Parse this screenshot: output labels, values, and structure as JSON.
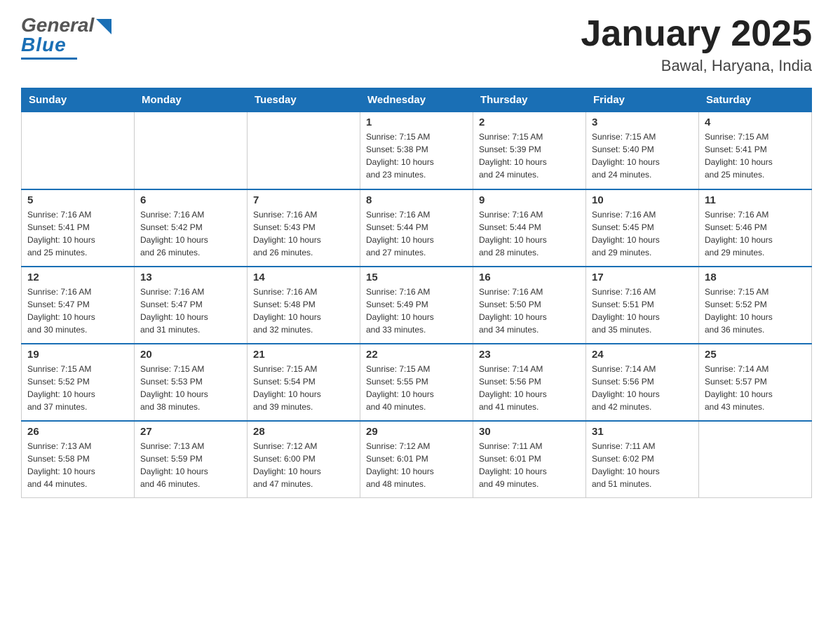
{
  "header": {
    "logo_general": "General",
    "logo_blue": "Blue",
    "month_year": "January 2025",
    "location": "Bawal, Haryana, India"
  },
  "days_of_week": [
    "Sunday",
    "Monday",
    "Tuesday",
    "Wednesday",
    "Thursday",
    "Friday",
    "Saturday"
  ],
  "weeks": [
    [
      {
        "day": "",
        "info": ""
      },
      {
        "day": "",
        "info": ""
      },
      {
        "day": "",
        "info": ""
      },
      {
        "day": "1",
        "info": "Sunrise: 7:15 AM\nSunset: 5:38 PM\nDaylight: 10 hours\nand 23 minutes."
      },
      {
        "day": "2",
        "info": "Sunrise: 7:15 AM\nSunset: 5:39 PM\nDaylight: 10 hours\nand 24 minutes."
      },
      {
        "day": "3",
        "info": "Sunrise: 7:15 AM\nSunset: 5:40 PM\nDaylight: 10 hours\nand 24 minutes."
      },
      {
        "day": "4",
        "info": "Sunrise: 7:15 AM\nSunset: 5:41 PM\nDaylight: 10 hours\nand 25 minutes."
      }
    ],
    [
      {
        "day": "5",
        "info": "Sunrise: 7:16 AM\nSunset: 5:41 PM\nDaylight: 10 hours\nand 25 minutes."
      },
      {
        "day": "6",
        "info": "Sunrise: 7:16 AM\nSunset: 5:42 PM\nDaylight: 10 hours\nand 26 minutes."
      },
      {
        "day": "7",
        "info": "Sunrise: 7:16 AM\nSunset: 5:43 PM\nDaylight: 10 hours\nand 26 minutes."
      },
      {
        "day": "8",
        "info": "Sunrise: 7:16 AM\nSunset: 5:44 PM\nDaylight: 10 hours\nand 27 minutes."
      },
      {
        "day": "9",
        "info": "Sunrise: 7:16 AM\nSunset: 5:44 PM\nDaylight: 10 hours\nand 28 minutes."
      },
      {
        "day": "10",
        "info": "Sunrise: 7:16 AM\nSunset: 5:45 PM\nDaylight: 10 hours\nand 29 minutes."
      },
      {
        "day": "11",
        "info": "Sunrise: 7:16 AM\nSunset: 5:46 PM\nDaylight: 10 hours\nand 29 minutes."
      }
    ],
    [
      {
        "day": "12",
        "info": "Sunrise: 7:16 AM\nSunset: 5:47 PM\nDaylight: 10 hours\nand 30 minutes."
      },
      {
        "day": "13",
        "info": "Sunrise: 7:16 AM\nSunset: 5:47 PM\nDaylight: 10 hours\nand 31 minutes."
      },
      {
        "day": "14",
        "info": "Sunrise: 7:16 AM\nSunset: 5:48 PM\nDaylight: 10 hours\nand 32 minutes."
      },
      {
        "day": "15",
        "info": "Sunrise: 7:16 AM\nSunset: 5:49 PM\nDaylight: 10 hours\nand 33 minutes."
      },
      {
        "day": "16",
        "info": "Sunrise: 7:16 AM\nSunset: 5:50 PM\nDaylight: 10 hours\nand 34 minutes."
      },
      {
        "day": "17",
        "info": "Sunrise: 7:16 AM\nSunset: 5:51 PM\nDaylight: 10 hours\nand 35 minutes."
      },
      {
        "day": "18",
        "info": "Sunrise: 7:15 AM\nSunset: 5:52 PM\nDaylight: 10 hours\nand 36 minutes."
      }
    ],
    [
      {
        "day": "19",
        "info": "Sunrise: 7:15 AM\nSunset: 5:52 PM\nDaylight: 10 hours\nand 37 minutes."
      },
      {
        "day": "20",
        "info": "Sunrise: 7:15 AM\nSunset: 5:53 PM\nDaylight: 10 hours\nand 38 minutes."
      },
      {
        "day": "21",
        "info": "Sunrise: 7:15 AM\nSunset: 5:54 PM\nDaylight: 10 hours\nand 39 minutes."
      },
      {
        "day": "22",
        "info": "Sunrise: 7:15 AM\nSunset: 5:55 PM\nDaylight: 10 hours\nand 40 minutes."
      },
      {
        "day": "23",
        "info": "Sunrise: 7:14 AM\nSunset: 5:56 PM\nDaylight: 10 hours\nand 41 minutes."
      },
      {
        "day": "24",
        "info": "Sunrise: 7:14 AM\nSunset: 5:56 PM\nDaylight: 10 hours\nand 42 minutes."
      },
      {
        "day": "25",
        "info": "Sunrise: 7:14 AM\nSunset: 5:57 PM\nDaylight: 10 hours\nand 43 minutes."
      }
    ],
    [
      {
        "day": "26",
        "info": "Sunrise: 7:13 AM\nSunset: 5:58 PM\nDaylight: 10 hours\nand 44 minutes."
      },
      {
        "day": "27",
        "info": "Sunrise: 7:13 AM\nSunset: 5:59 PM\nDaylight: 10 hours\nand 46 minutes."
      },
      {
        "day": "28",
        "info": "Sunrise: 7:12 AM\nSunset: 6:00 PM\nDaylight: 10 hours\nand 47 minutes."
      },
      {
        "day": "29",
        "info": "Sunrise: 7:12 AM\nSunset: 6:01 PM\nDaylight: 10 hours\nand 48 minutes."
      },
      {
        "day": "30",
        "info": "Sunrise: 7:11 AM\nSunset: 6:01 PM\nDaylight: 10 hours\nand 49 minutes."
      },
      {
        "day": "31",
        "info": "Sunrise: 7:11 AM\nSunset: 6:02 PM\nDaylight: 10 hours\nand 51 minutes."
      },
      {
        "day": "",
        "info": ""
      }
    ]
  ]
}
